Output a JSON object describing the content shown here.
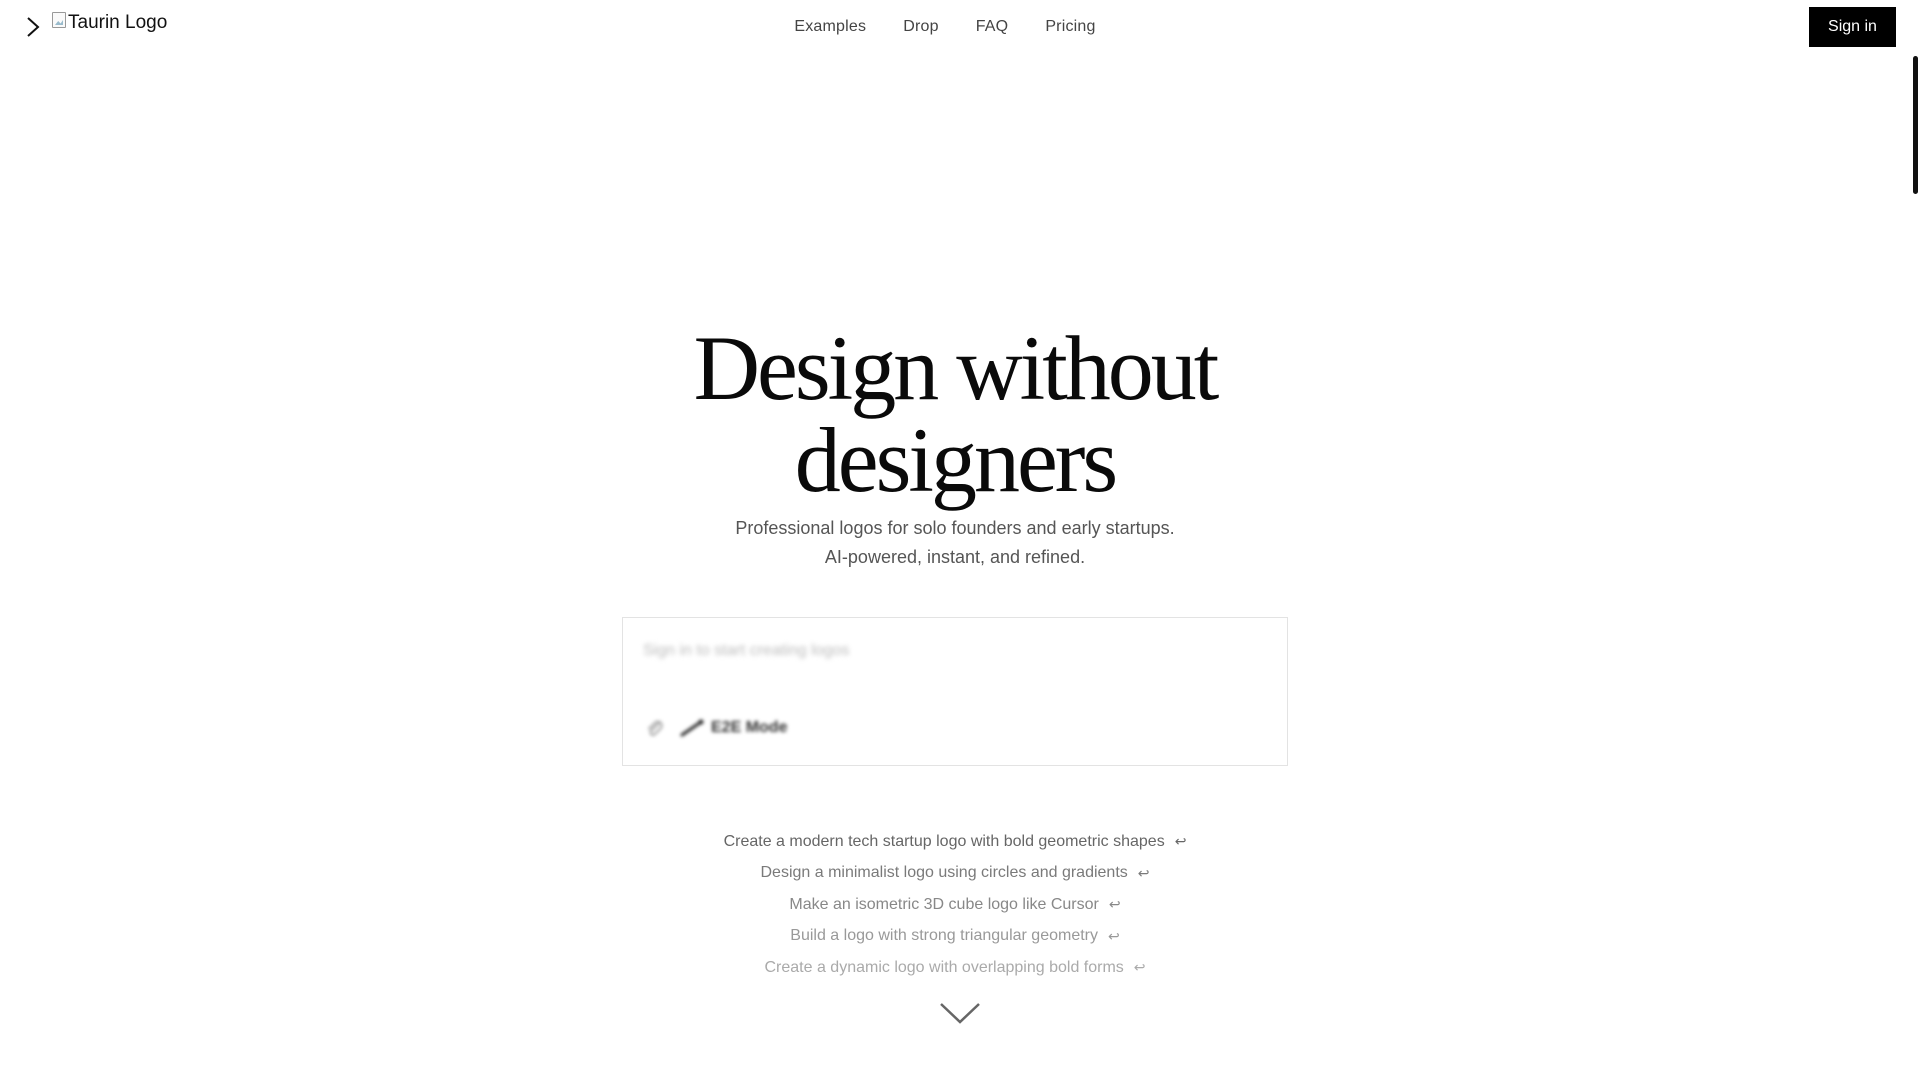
{
  "header": {
    "logo_alt": "Taurin Logo",
    "nav": [
      "Examples",
      "Drop",
      "FAQ",
      "Pricing"
    ],
    "signin_label": "Sign in"
  },
  "hero": {
    "title_line1": "Design without",
    "title_line2": "designers",
    "subtitle_line1": "Professional logos for solo founders and early startups.",
    "subtitle_line2": "AI-powered, instant, and refined."
  },
  "prompt": {
    "placeholder": "Sign in to start creating logos",
    "mode_label": "E2E Mode"
  },
  "suggestions": [
    "Create a modern tech startup logo with bold geometric shapes",
    "Design a minimalist logo using circles and gradients",
    "Make an isometric 3D cube logo like Cursor",
    "Build a logo with strong triangular geometry",
    "Create a dynamic logo with overlapping bold forms"
  ],
  "icons": {
    "sidebar_toggle": "chevron-right-icon",
    "attach": "paperclip-icon",
    "mode": "wand-icon",
    "return": "return-arrow-icon",
    "scroll": "chevron-down-icon"
  },
  "colors": {
    "primary_button": "#000000",
    "text": "#111111",
    "muted": "#555555"
  }
}
